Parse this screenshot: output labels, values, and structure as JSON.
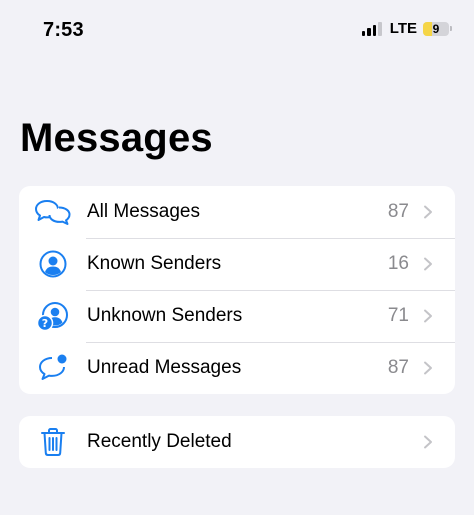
{
  "status_bar": {
    "time": "7:53",
    "network": "LTE",
    "battery_level": "9",
    "battery_fraction": 0.35,
    "signal_bars_active": 3
  },
  "page": {
    "title": "Messages"
  },
  "colors": {
    "accent": "#1a7ff0",
    "background": "#f2f2f7",
    "secondary_text": "#8a8a8e",
    "battery_low": "#f5d547"
  },
  "filters": [
    {
      "label": "All Messages",
      "count": "87",
      "icon": "chat-bubbles-icon"
    },
    {
      "label": "Known Senders",
      "count": "16",
      "icon": "person-circle-icon"
    },
    {
      "label": "Unknown Senders",
      "count": "71",
      "icon": "person-question-icon"
    },
    {
      "label": "Unread Messages",
      "count": "87",
      "icon": "unread-bubble-icon"
    }
  ],
  "deleted": {
    "label": "Recently Deleted",
    "icon": "trash-icon"
  }
}
